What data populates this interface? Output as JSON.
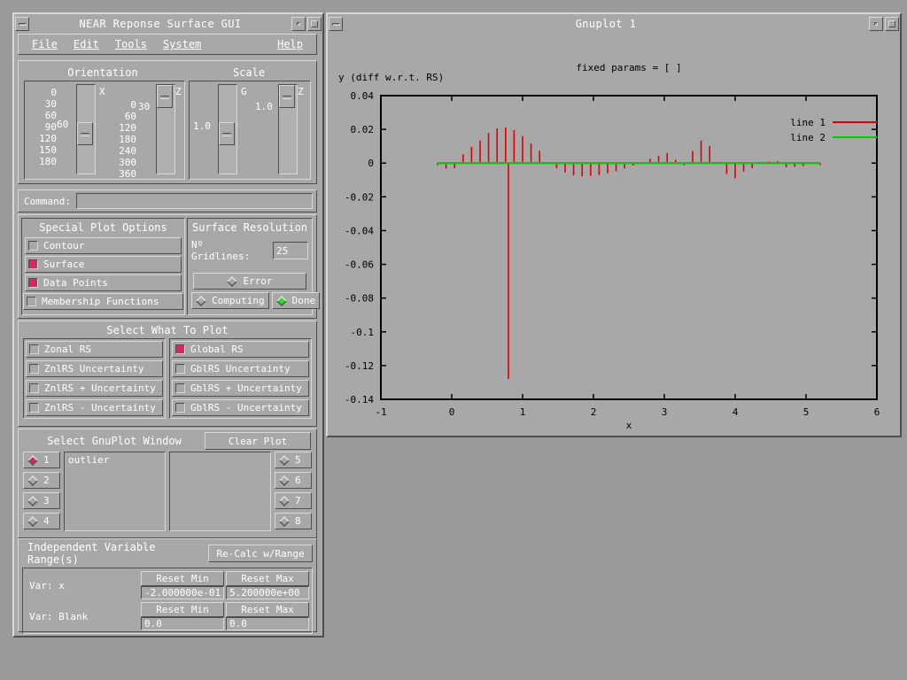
{
  "gui_window": {
    "title": "NEAR Reponse Surface GUI",
    "menu": [
      "File",
      "Edit",
      "Tools",
      "System"
    ],
    "help_label": "Help",
    "orientation": {
      "group_title": "Orientation",
      "x_axis_label": "X",
      "z_axis_label": "Z",
      "x_value": "60",
      "z_value": "30",
      "x_ticks": [
        "0",
        "30",
        "60",
        "90",
        "120",
        "150",
        "180"
      ],
      "z_ticks": [
        "0",
        "60",
        "120",
        "180",
        "240",
        "300",
        "360"
      ]
    },
    "scale": {
      "group_title": "Scale",
      "g_axis_label": "G",
      "z_axis_label": "Z",
      "g_value": "1.0",
      "z_value": "1.0"
    },
    "command": {
      "label": "Command:",
      "value": "",
      "placeholder": ""
    },
    "special_plot_options": {
      "title": "Special Plot Options",
      "items": [
        {
          "label": "Contour",
          "checked": false
        },
        {
          "label": "Surface",
          "checked": true
        },
        {
          "label": "Data Points",
          "checked": true
        },
        {
          "label": "Membership Functions",
          "checked": false
        }
      ]
    },
    "surface_resolution": {
      "title": "Surface Resolution",
      "gridlines_label": "Nº Gridlines:",
      "gridlines_value": "25",
      "status": [
        {
          "label": "Error",
          "active": false
        },
        {
          "label": "Computing",
          "active": false
        },
        {
          "label": "Done",
          "active": true
        }
      ]
    },
    "select_what_to_plot": {
      "title": "Select What To Plot",
      "left": [
        {
          "label": "Zonal RS",
          "checked": false
        },
        {
          "label": "ZnlRS Uncertainty",
          "checked": false
        },
        {
          "label": "ZnlRS + Uncertainty",
          "checked": false
        },
        {
          "label": "ZnlRS - Uncertainty",
          "checked": false
        }
      ],
      "right": [
        {
          "label": "Global RS",
          "checked": true
        },
        {
          "label": "GblRS Uncertainty",
          "checked": false
        },
        {
          "label": "GblRS + Uncertainty",
          "checked": false
        },
        {
          "label": "GblRS - Uncertainty",
          "checked": false
        }
      ]
    },
    "gnuplot_window": {
      "title": "Select GnuPlot Window",
      "clear_plot_label": "Clear Plot",
      "left_radios": [
        {
          "label": "1",
          "selected": true
        },
        {
          "label": "2",
          "selected": false
        },
        {
          "label": "3",
          "selected": false
        },
        {
          "label": "4",
          "selected": false
        }
      ],
      "right_radios": [
        {
          "label": "5",
          "selected": false
        },
        {
          "label": "6",
          "selected": false
        },
        {
          "label": "7",
          "selected": false
        },
        {
          "label": "8",
          "selected": false
        }
      ],
      "text_left": "outlier",
      "text_right": ""
    },
    "independent_variable_range": {
      "title": "Independent Variable Range(s)",
      "recalc_label": "Re-Calc w/Range",
      "rows": [
        {
          "var_label": "Var: x",
          "reset_min_label": "Reset Min",
          "reset_max_label": "Reset Max",
          "min_value": "-2.000000e-01",
          "max_value": "5.200000e+00"
        },
        {
          "var_label": "Var: Blank",
          "reset_min_label": "Reset Min",
          "reset_max_label": "Reset Max",
          "min_value": "0.0",
          "max_value": "0.0"
        }
      ]
    }
  },
  "plot_window": {
    "title": "Gnuplot 1"
  },
  "chart_data": {
    "type": "bar",
    "title": "fixed params = [ ]",
    "xlabel": "x",
    "ylabel": "y (diff w.r.t. RS)",
    "xlim": [
      -1,
      6
    ],
    "ylim": [
      -0.14,
      0.04
    ],
    "xticks": [
      "-1",
      "0",
      "1",
      "2",
      "3",
      "4",
      "5",
      "6"
    ],
    "yticks": [
      "0.04",
      "0.02",
      "0",
      "-0.02",
      "-0.04",
      "-0.06",
      "-0.08",
      "-0.1",
      "-0.12",
      "-0.14"
    ],
    "grid": false,
    "legend_position": "top-right",
    "series": [
      {
        "name": "line 1",
        "color": "#e00000",
        "style": "impulses",
        "x": [
          -0.2,
          -0.08,
          0.04,
          0.16,
          0.28,
          0.4,
          0.52,
          0.64,
          0.76,
          0.8,
          0.88,
          1.0,
          1.12,
          1.24,
          1.36,
          1.48,
          1.6,
          1.72,
          1.84,
          1.96,
          2.08,
          2.2,
          2.32,
          2.44,
          2.56,
          2.68,
          2.8,
          2.92,
          3.04,
          3.16,
          3.28,
          3.4,
          3.52,
          3.64,
          3.76,
          3.88,
          4.0,
          4.12,
          4.24,
          4.36,
          4.48,
          4.6,
          4.72,
          4.84,
          4.96,
          5.08,
          5.2
        ],
        "y": [
          -0.0012,
          -0.0032,
          -0.003,
          0.0052,
          0.0096,
          0.0134,
          0.0178,
          0.0206,
          0.0212,
          -0.128,
          0.0196,
          0.016,
          0.0116,
          0.0074,
          0.0006,
          -0.003,
          -0.0056,
          -0.0072,
          -0.0078,
          -0.0076,
          -0.007,
          -0.006,
          -0.0048,
          -0.0032,
          -0.0014,
          0.0006,
          0.0026,
          0.0044,
          0.006,
          0.002,
          -0.0012,
          0.0072,
          0.0134,
          0.0102,
          0.0008,
          -0.0064,
          -0.009,
          -0.005,
          -0.003,
          0.0008,
          0.001,
          0.0012,
          -0.0024,
          -0.0022,
          -0.0018,
          0.0006,
          -0.0012
        ]
      },
      {
        "name": "line 2",
        "color": "#00d000",
        "style": "line",
        "x": [
          -0.2,
          5.2
        ],
        "y": [
          0.0,
          0.0
        ]
      }
    ]
  }
}
